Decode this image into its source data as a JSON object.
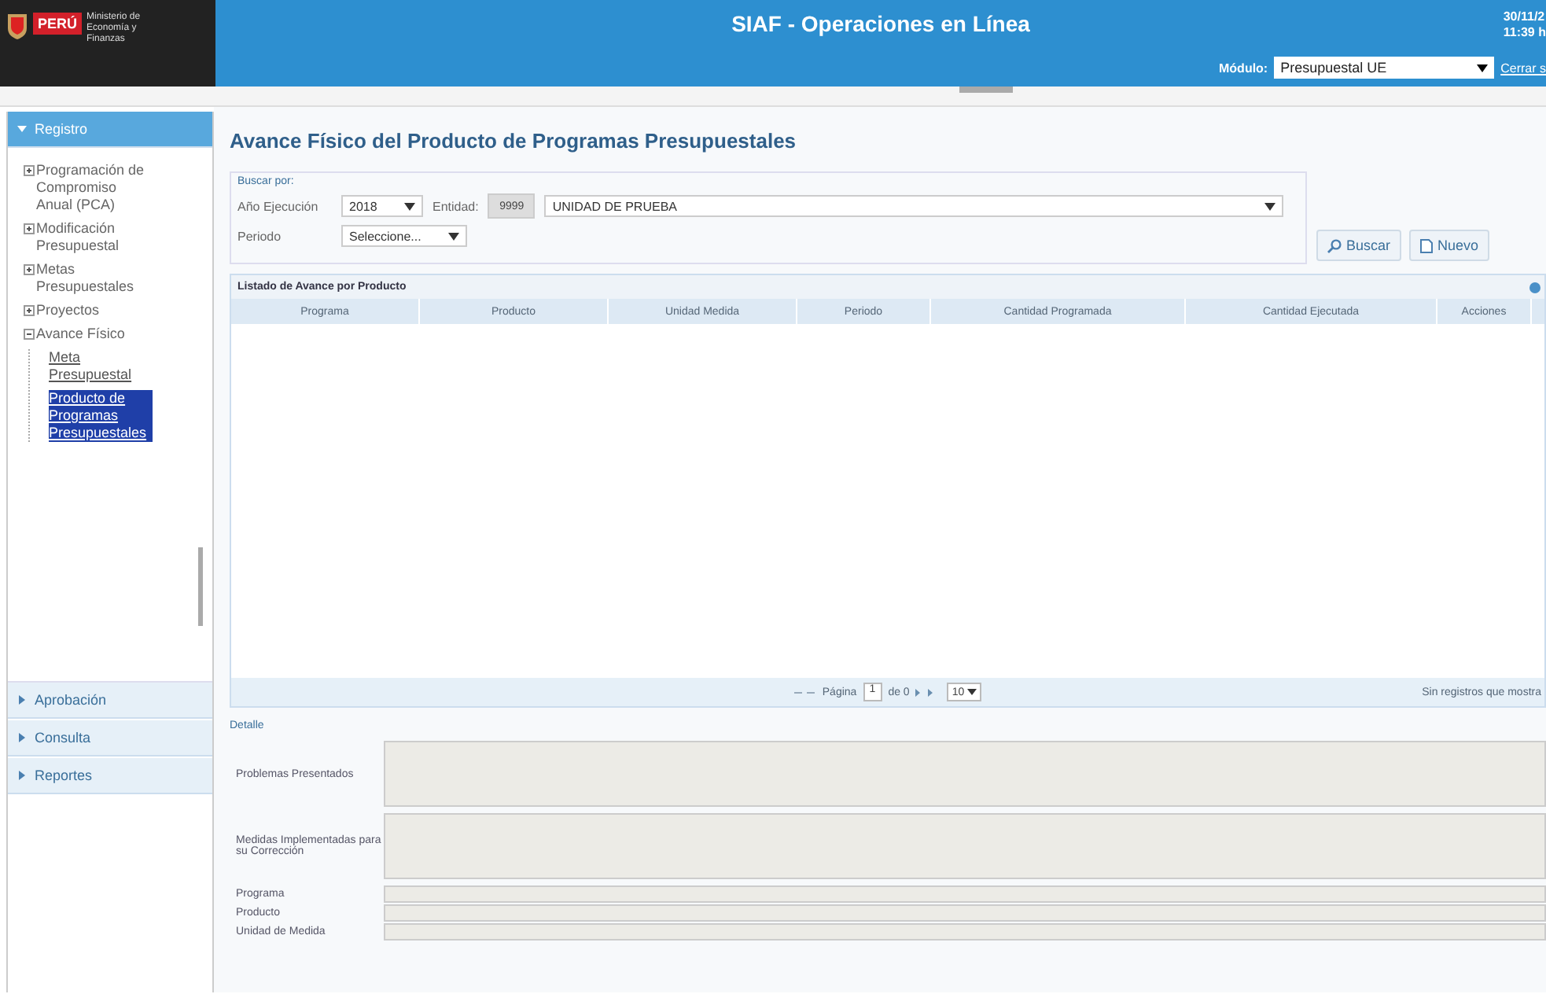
{
  "header": {
    "org_short": "PERÚ",
    "org_name": "Ministerio de Economía y Finanzas",
    "title": "SIAF - Operaciones en Línea",
    "date": "30/11/2",
    "time": "11:39 h",
    "module_label": "Módulo:",
    "module_value": "Presupuestal UE",
    "logout": "Cerrar s"
  },
  "sidebar": {
    "sections": [
      {
        "label": "Registro",
        "expanded": true,
        "tree": [
          {
            "label": "Programación de Compromiso Anual (PCA)",
            "expanded": false,
            "selected": false
          },
          {
            "label": "Modificación Presupuestal",
            "expanded": false,
            "selected": false
          },
          {
            "label": "Metas Presupuestales",
            "expanded": false,
            "selected": false
          },
          {
            "label": "Proyectos",
            "expanded": false,
            "selected": false
          },
          {
            "label": "Avance Físico",
            "expanded": true,
            "selected": false,
            "children": [
              {
                "label": "Meta Presupuestal",
                "selected": false
              },
              {
                "label": "Producto de Programas Presupuestales",
                "selected": true
              }
            ]
          }
        ]
      },
      {
        "label": "Aprobación",
        "expanded": false
      },
      {
        "label": "Consulta",
        "expanded": false
      },
      {
        "label": "Reportes",
        "expanded": false
      }
    ]
  },
  "page_title": "Avance Físico del Producto de Programas Presupuestales",
  "search": {
    "legend": "Buscar por:",
    "year_label": "Año Ejecución",
    "year_value": "2018",
    "entity_label": "Entidad:",
    "entity_code": "9999",
    "entity_value": "UNIDAD DE PRUEBA",
    "period_label": "Periodo",
    "period_value": "Seleccione..."
  },
  "buttons": [
    {
      "kind": "search",
      "label": "Buscar"
    },
    {
      "kind": "new",
      "label": "Nuevo"
    }
  ],
  "grid": {
    "title": "Listado de Avance por Producto",
    "columns": [
      "Programa",
      "Producto",
      "Unidad Medida",
      "Periodo",
      "Cantidad Programada",
      "Cantidad Ejecutada",
      "Acciones"
    ],
    "pager": {
      "page_label": "Página",
      "page_value": "1",
      "of_label": "de 0",
      "page_size": "10",
      "empty": "Sin registros que mostra"
    }
  },
  "detail": {
    "title": "Detalle",
    "fields": [
      {
        "label": "Problemas Presentados",
        "kind": "textarea"
      },
      {
        "label": "Medidas Implementadas para su Corrección",
        "kind": "textarea"
      },
      {
        "label": "Programa",
        "kind": "text"
      },
      {
        "label": "Producto",
        "kind": "text"
      },
      {
        "label": "Unidad de Medida",
        "kind": "text"
      }
    ]
  }
}
